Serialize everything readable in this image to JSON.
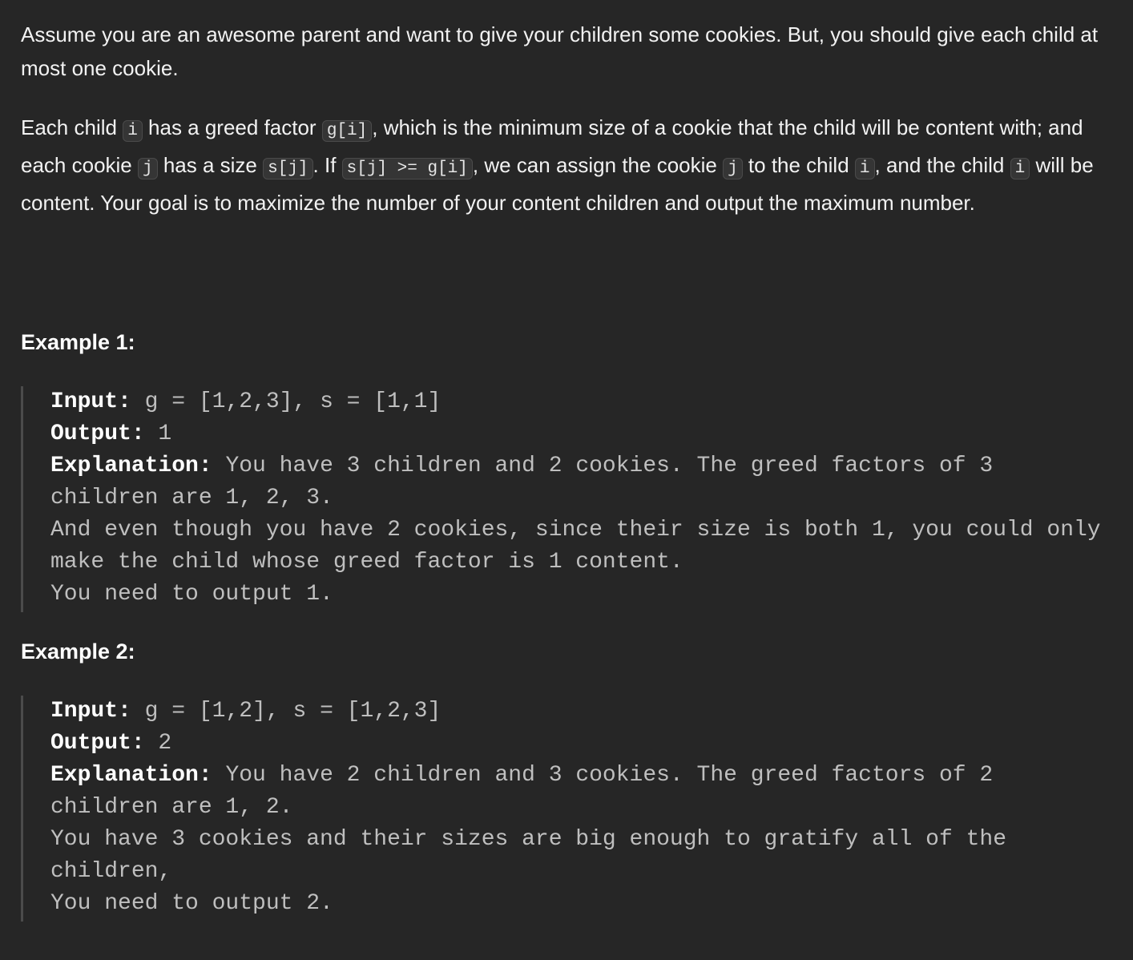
{
  "intro": {
    "p1": "Assume you are an awesome parent and want to give your children some cookies. But, you should give each child at most one cookie.",
    "p2": {
      "t1": "Each child ",
      "c1": "i",
      "t2": " has a greed factor ",
      "c2": "g[i]",
      "t3": ", which is the minimum size of a cookie that the child will be content with; and each cookie ",
      "c3": "j",
      "t4": " has a size ",
      "c4": "s[j]",
      "t5": ". If ",
      "c5": "s[j] >= g[i]",
      "t6": ", we can assign the cookie ",
      "c6": "j",
      "t7": " to the child ",
      "c7": "i",
      "t8": ", and the child ",
      "c8": "i",
      "t9": " will be content. Your goal is to maximize the number of your content children and output the maximum number."
    }
  },
  "examples": [
    {
      "title": "Example 1:",
      "input_label": "Input:",
      "input_value": " g = [1,2,3], s = [1,1]",
      "output_label": "Output:",
      "output_value": " 1",
      "explanation_label": "Explanation:",
      "explanation_value": " You have 3 children and 2 cookies. The greed factors of 3 children are 1, 2, 3.",
      "line2": "And even though you have 2 cookies, since their size is both 1, you could only make the child whose greed factor is 1 content.",
      "line3": "You need to output 1."
    },
    {
      "title": "Example 2:",
      "input_label": "Input:",
      "input_value": " g = [1,2], s = [1,2,3]",
      "output_label": "Output:",
      "output_value": " 2",
      "explanation_label": "Explanation:",
      "explanation_value": " You have 2 children and 3 cookies. The greed factors of 2 children are 1, 2.",
      "line2": "You have 3 cookies and their sizes are big enough to gratify all of the children,",
      "line3": "You need to output 2."
    }
  ]
}
